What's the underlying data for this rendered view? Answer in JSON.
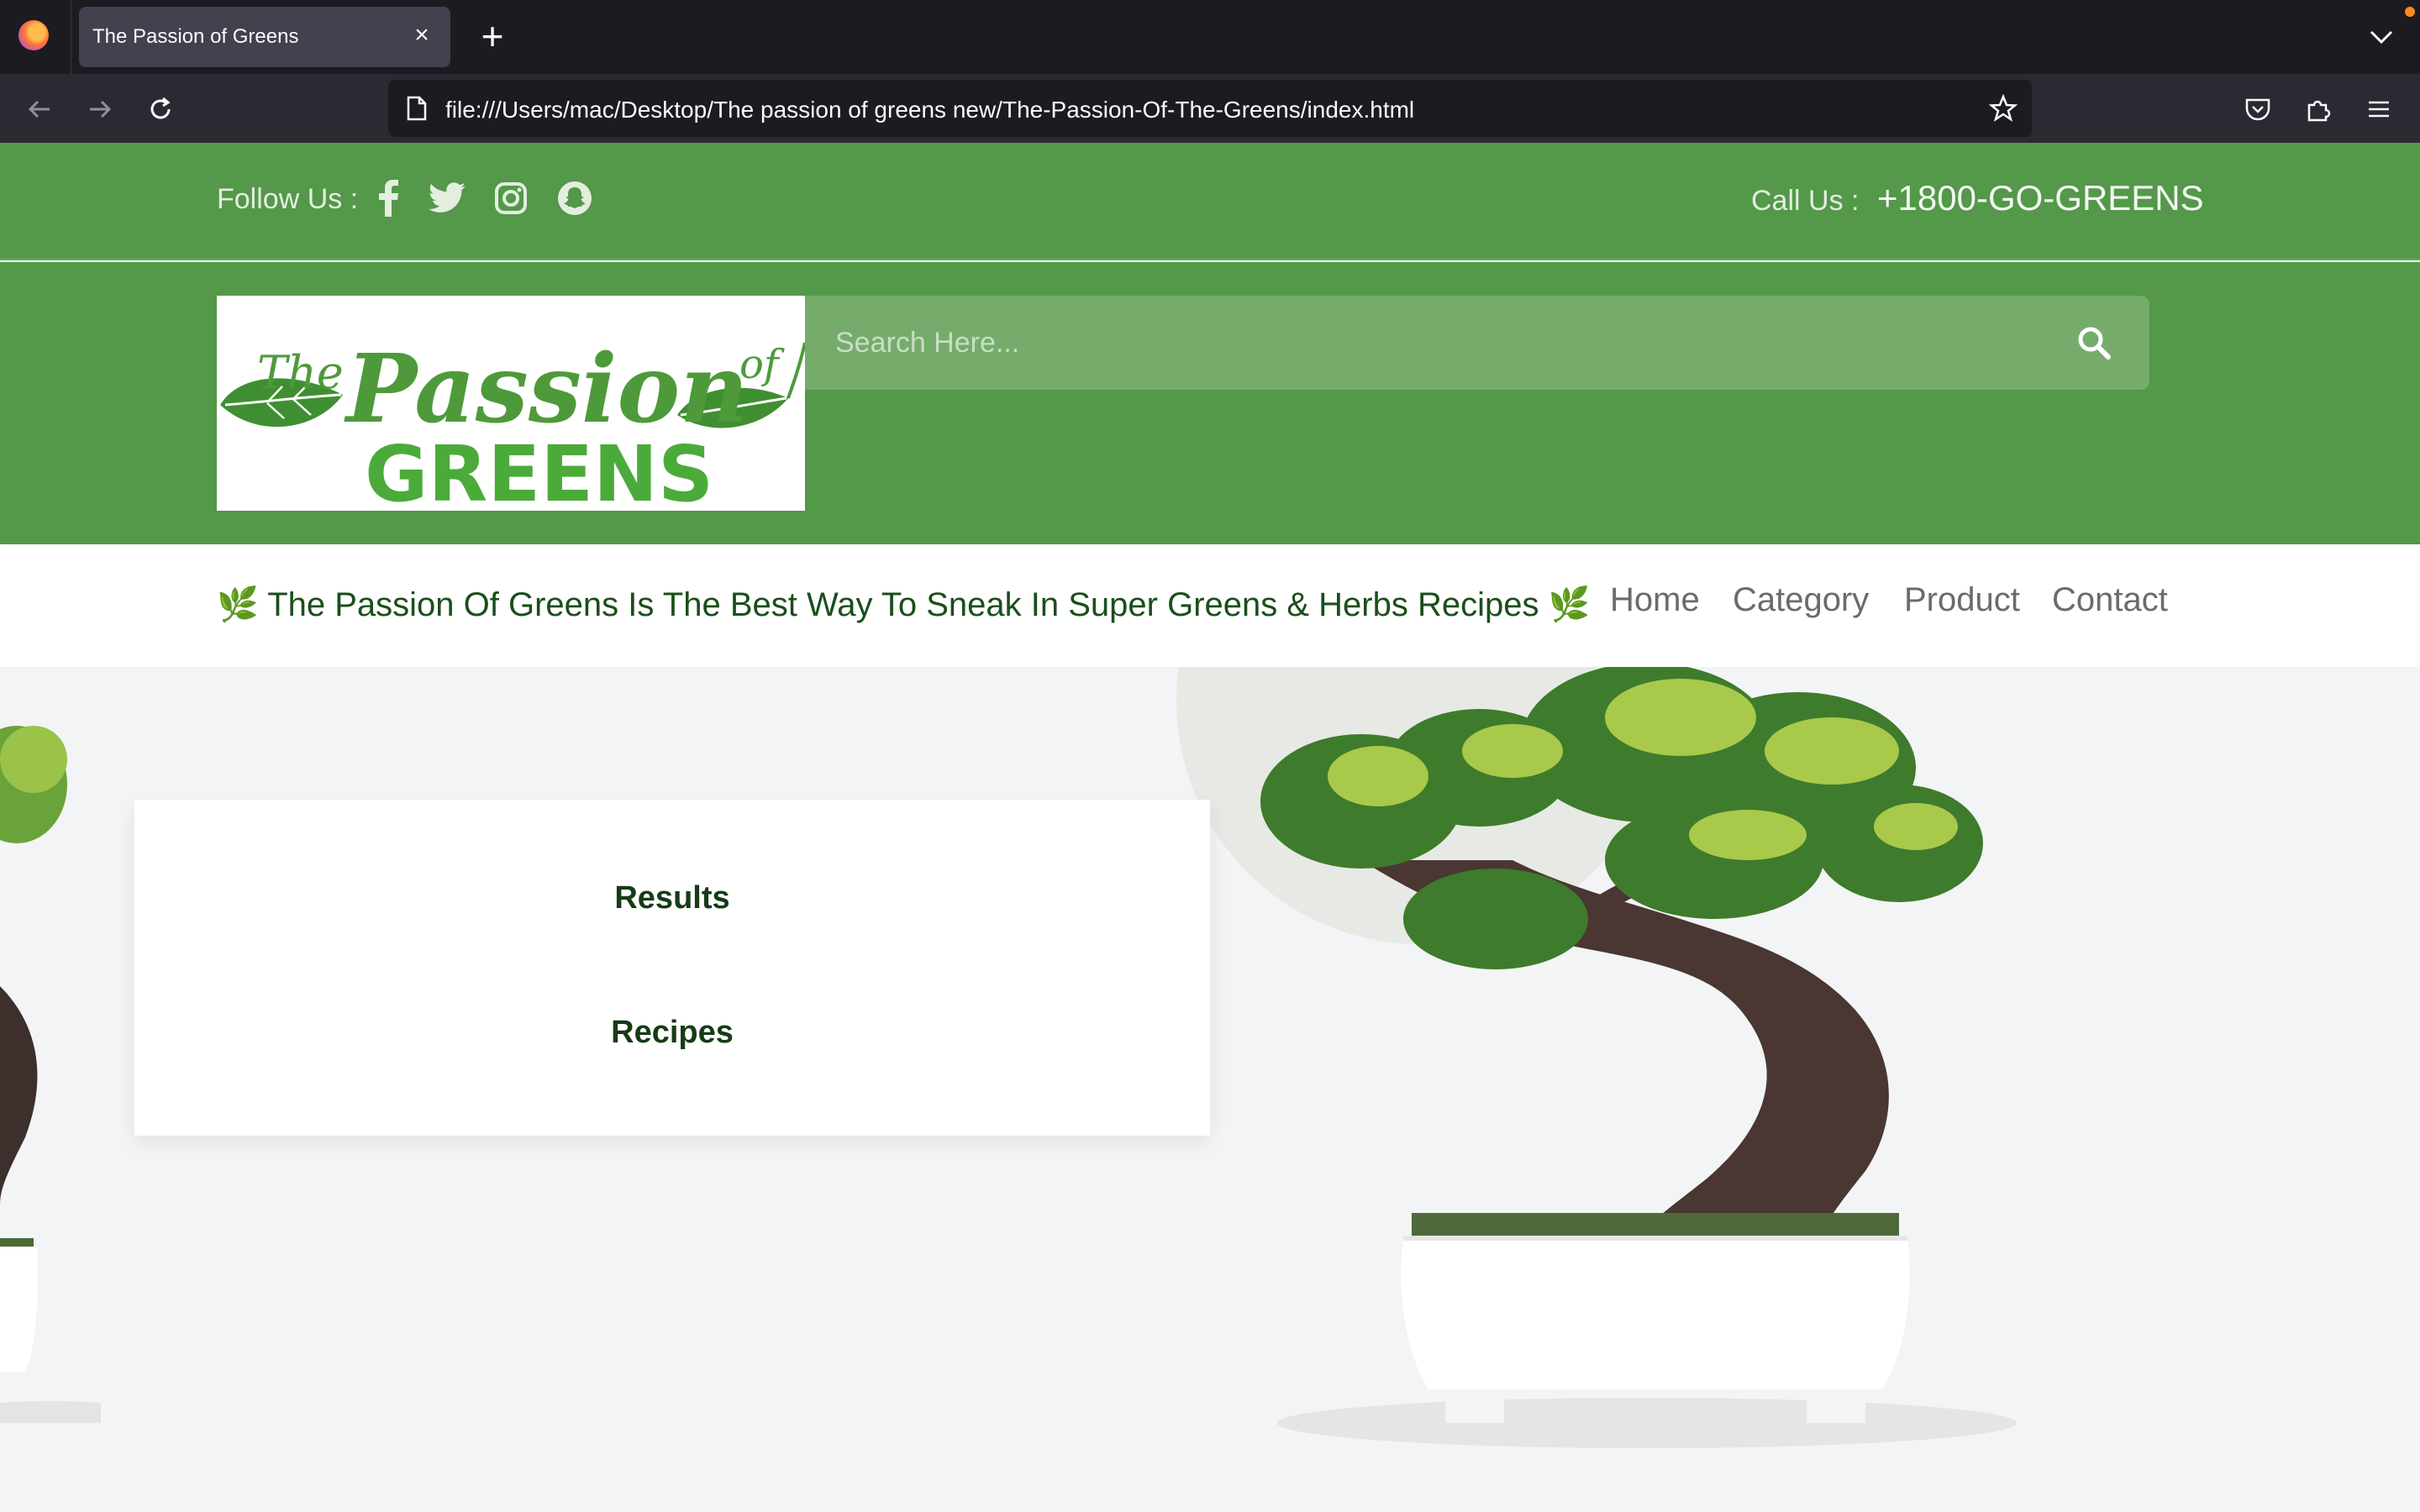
{
  "browser": {
    "tab_title": "The Passion of Greens",
    "tab_close": "×",
    "new_tab": "+",
    "url": "file:///Users/mac/Desktop/The passion of greens new/The-Passion-Of-The-Greens/index.html"
  },
  "topbar": {
    "follow_label": "Follow Us :",
    "social_icons": [
      "facebook-icon",
      "twitter-icon",
      "instagram-icon",
      "snapchat-icon"
    ],
    "call_label": "Call Us :",
    "phone": "+1800-GO-GREENS"
  },
  "logo": {
    "line1_the": "The",
    "line1_passion": "Passion",
    "line1_of": "of",
    "line2": "GREENS"
  },
  "search": {
    "placeholder": "Search Here..."
  },
  "menubar": {
    "tagline": "🌿 The Passion Of Greens Is The Best Way To Sneak In Super Greens & Herbs Recipes 🌿",
    "links": [
      "Home",
      "Category",
      "Product",
      "Contact"
    ]
  },
  "card": {
    "results": "Results",
    "recipes": "Recipes"
  },
  "colors": {
    "brand_green": "#54984a",
    "search_green": "#75ac6c",
    "dark_green": "#1b4e1b",
    "logo_green": "#4e9a3a"
  }
}
